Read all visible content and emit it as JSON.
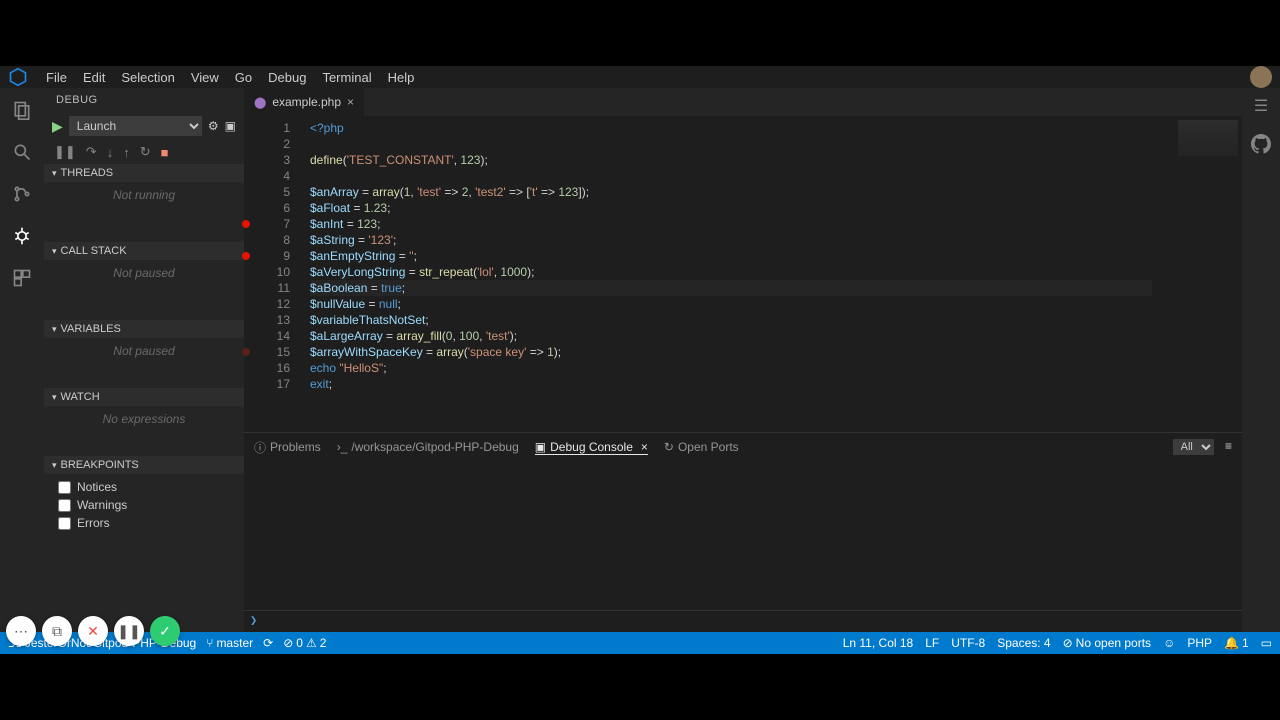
{
  "menu": {
    "items": [
      "File",
      "Edit",
      "Selection",
      "View",
      "Go",
      "Debug",
      "Terminal",
      "Help"
    ]
  },
  "sidebar": {
    "title": "DEBUG",
    "launch_config": "Launch",
    "sections": {
      "threads": {
        "label": "THREADS",
        "empty": "Not running"
      },
      "callstack": {
        "label": "CALL STACK",
        "empty": "Not paused"
      },
      "variables": {
        "label": "VARIABLES",
        "empty": "Not paused"
      },
      "watch": {
        "label": "WATCH",
        "empty": "No expressions"
      },
      "breakpoints": {
        "label": "BREAKPOINTS",
        "items": [
          "Notices",
          "Warnings",
          "Errors"
        ]
      }
    }
  },
  "tab": {
    "name": "example.php"
  },
  "editor": {
    "lines": [
      {
        "n": 1,
        "html": "<span class='kw'>&lt;?php</span>"
      },
      {
        "n": 2,
        "html": ""
      },
      {
        "n": 3,
        "html": "<span class='fn'>define</span>(<span class='str'>'TEST_CONSTANT'</span>, <span class='num'>123</span>);"
      },
      {
        "n": 4,
        "html": ""
      },
      {
        "n": 5,
        "html": "<span class='var'>$anArray</span> = <span class='fn'>array</span>(<span class='num'>1</span>, <span class='str'>'test'</span> =&gt; <span class='num'>2</span>, <span class='str'>'test2'</span> =&gt; [<span class='str'>'t'</span> =&gt; <span class='num'>123</span>]);"
      },
      {
        "n": 6,
        "html": "<span class='var'>$aFloat</span> = <span class='num'>1.23</span>;"
      },
      {
        "n": 7,
        "html": "<span class='var'>$anInt</span> = <span class='num'>123</span>;",
        "bp": true
      },
      {
        "n": 8,
        "html": "<span class='var'>$aString</span> = <span class='str'>'123'</span>;"
      },
      {
        "n": 9,
        "html": "<span class='var'>$anEmptyString</span> = <span class='str'>''</span>;",
        "bp": true
      },
      {
        "n": 10,
        "html": "<span class='var'>$aVeryLongString</span> = <span class='fn'>str_repeat</span>(<span class='str'>'lol'</span>, <span class='num'>1000</span>);"
      },
      {
        "n": 11,
        "html": "<span class='var'>$aBoolean</span> = <span class='bool'>true</span>;",
        "current": true
      },
      {
        "n": 12,
        "html": "<span class='var'>$nullValue</span> = <span class='bool'>null</span>;"
      },
      {
        "n": 13,
        "html": "<span class='var'>$variableThatsNotSet</span>;"
      },
      {
        "n": 14,
        "html": "<span class='var'>$aLargeArray</span> = <span class='fn'>array_fill</span>(<span class='num'>0</span>, <span class='num'>100</span>, <span class='str'>'test'</span>);"
      },
      {
        "n": 15,
        "html": "<span class='var'>$arrayWithSpaceKey</span> = <span class='fn'>array</span>(<span class='str'>'space key'</span> =&gt; <span class='num'>1</span>);",
        "bp": true,
        "dim": true
      },
      {
        "n": 16,
        "html": "<span class='kw'>echo</span> <span class='str'>\"HelloS\"</span>;"
      },
      {
        "n": 17,
        "html": "<span class='kw'>exit</span>;"
      }
    ]
  },
  "panel": {
    "tabs": {
      "problems": "Problems",
      "workspace": "/workspace/Gitpod-PHP-Debug",
      "debug_console": "Debug Console",
      "open_ports": "Open Ports"
    },
    "filter": "All",
    "prompt": "❯"
  },
  "status": {
    "repo": "JesterOrNot/Gitpod-PHP-Debug",
    "branch": "master",
    "problems_err": "0",
    "problems_warn": "2",
    "cursor": "Ln 11, Col 18",
    "eol": "LF",
    "encoding": "UTF-8",
    "spaces": "Spaces: 4",
    "ports": "No open ports",
    "lang": "PHP",
    "notif": "1"
  }
}
